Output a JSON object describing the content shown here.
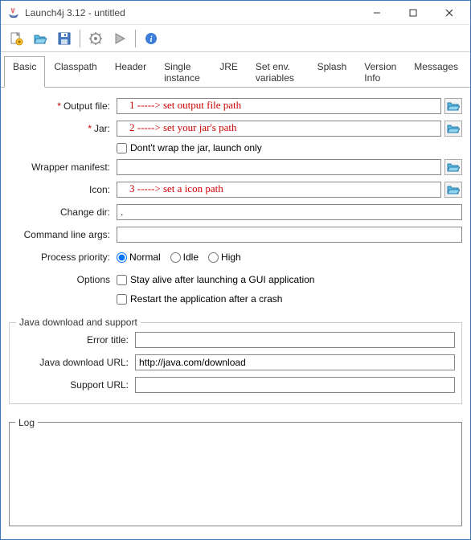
{
  "window": {
    "title": "Launch4j 3.12 - untitled"
  },
  "tabs": [
    "Basic",
    "Classpath",
    "Header",
    "Single instance",
    "JRE",
    "Set env. variables",
    "Splash",
    "Version Info",
    "Messages"
  ],
  "basic": {
    "output_file_label": "Output file:",
    "output_file_value": "",
    "jar_label": "Jar:",
    "jar_value": "",
    "dont_wrap_label": "Dont't wrap the jar, launch only",
    "wrapper_manifest_label": "Wrapper manifest:",
    "wrapper_manifest_value": "",
    "icon_label": "Icon:",
    "icon_value": "",
    "change_dir_label": "Change dir:",
    "change_dir_value": ".",
    "cmd_args_label": "Command line args:",
    "cmd_args_value": "",
    "priority_label": "Process priority:",
    "priority_normal": "Normal",
    "priority_idle": "Idle",
    "priority_high": "High",
    "options_label": "Options",
    "stay_alive_label": "Stay alive after launching a GUI application",
    "restart_label": "Restart the application after a crash"
  },
  "download": {
    "legend": "Java download and support",
    "error_title_label": "Error title:",
    "error_title_value": "",
    "java_url_label": "Java download URL:",
    "java_url_value": "http://java.com/download",
    "support_url_label": "Support URL:",
    "support_url_value": ""
  },
  "log": {
    "legend": "Log",
    "content": ""
  },
  "annotations": {
    "a1": "1    -----> set output file path",
    "a2": "2    -----> set your jar's path",
    "a3": "3    -----> set a icon path"
  }
}
